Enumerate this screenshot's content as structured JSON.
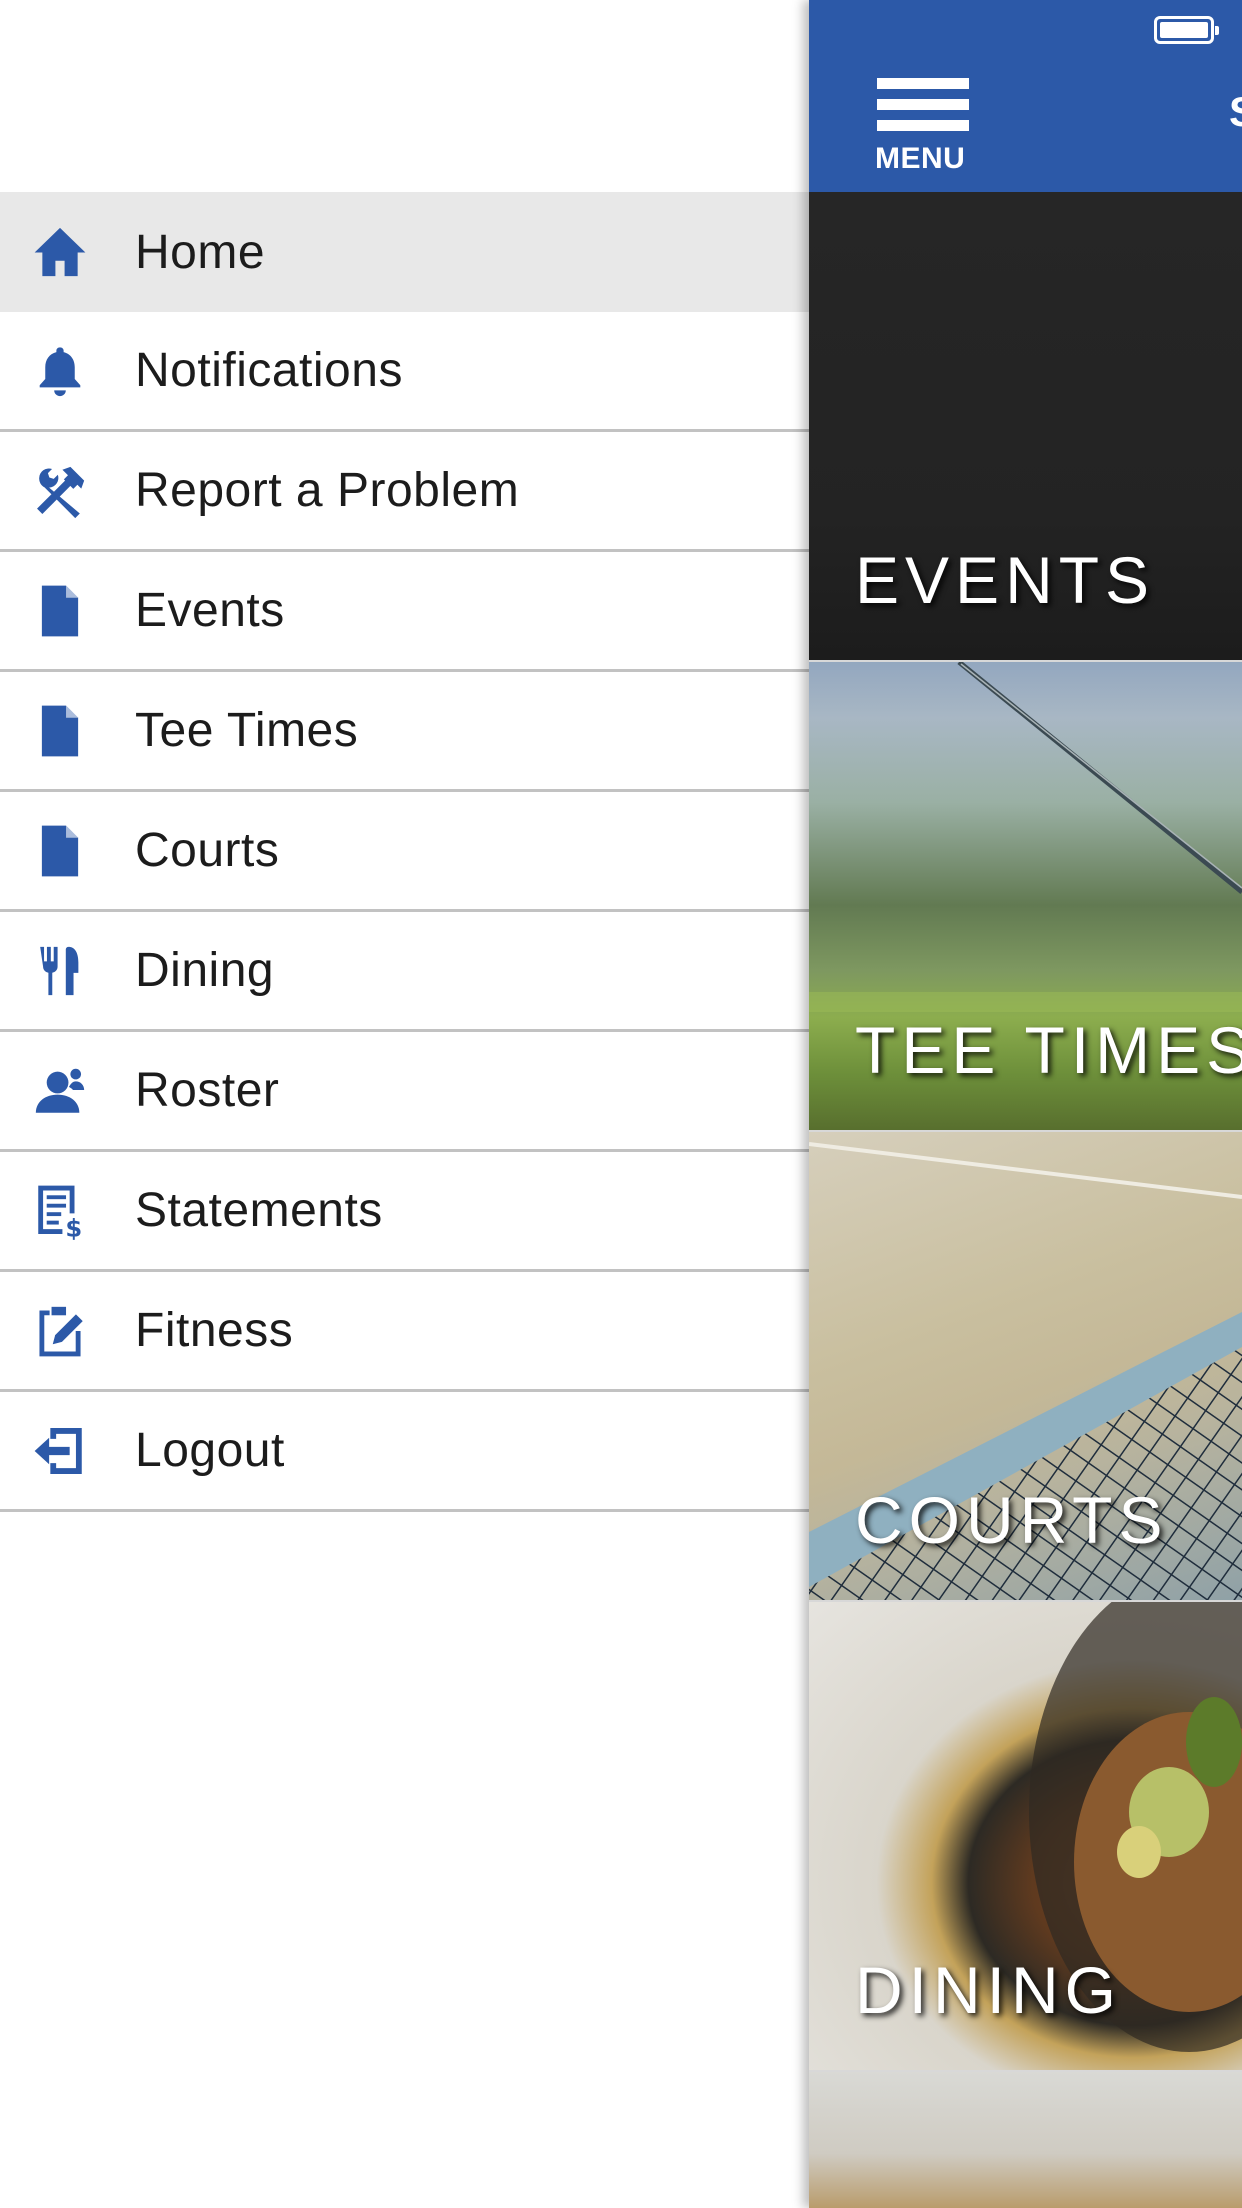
{
  "status_bar": {
    "battery_level": 1.0
  },
  "menu": {
    "items": [
      {
        "label": "Home",
        "icon": "home-icon",
        "active": true
      },
      {
        "label": "Notifications",
        "icon": "bell-icon"
      },
      {
        "label": "Report a Problem",
        "icon": "tools-icon"
      },
      {
        "label": "Events",
        "icon": "document-icon"
      },
      {
        "label": "Tee Times",
        "icon": "document-icon"
      },
      {
        "label": "Courts",
        "icon": "document-icon"
      },
      {
        "label": "Dining",
        "icon": "fork-knife-icon"
      },
      {
        "label": "Roster",
        "icon": "user-icon"
      },
      {
        "label": "Statements",
        "icon": "statement-icon"
      },
      {
        "label": "Fitness",
        "icon": "clipboard-edit-icon"
      },
      {
        "label": "Logout",
        "icon": "logout-icon"
      }
    ]
  },
  "header": {
    "menu_button_label": "MENU",
    "title_clipped": "S",
    "color": "#2c59a8"
  },
  "tiles": [
    {
      "title": "EVENTS"
    },
    {
      "title": "TEE TIMES"
    },
    {
      "title": "COURTS"
    },
    {
      "title": "DINING"
    }
  ],
  "colors": {
    "accent": "#2c59a8",
    "active_row": "#e8e8e8",
    "divider": "#c2c2c2"
  }
}
